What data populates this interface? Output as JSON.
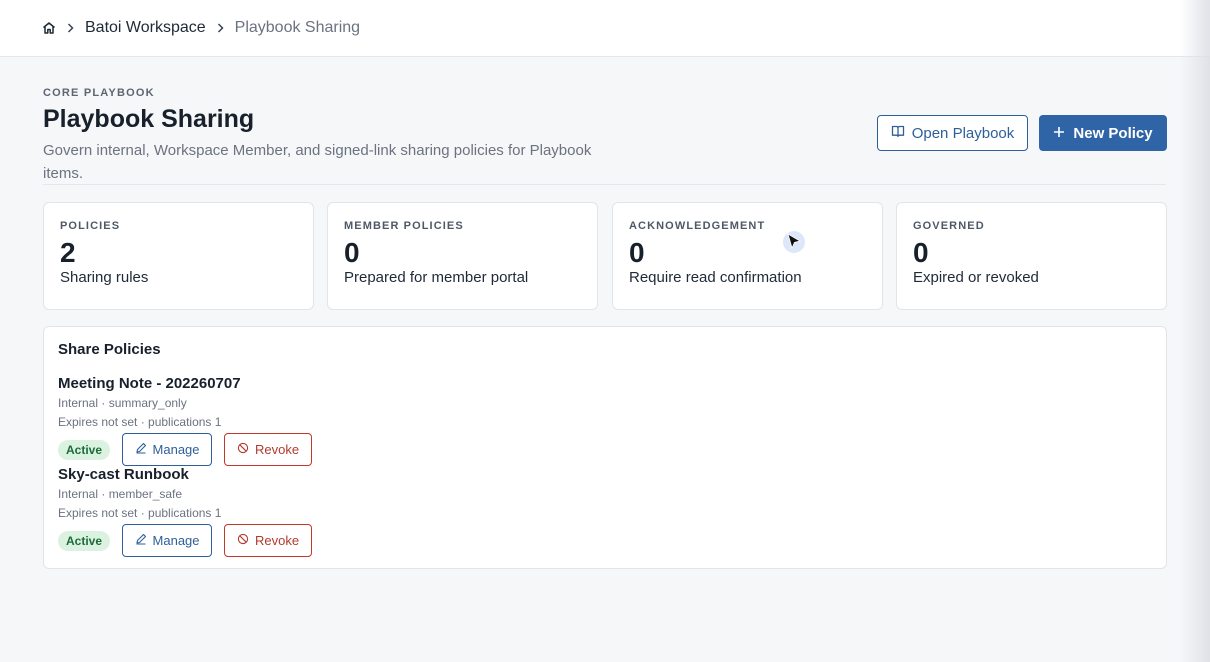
{
  "breadcrumb": {
    "home_icon": "home-icon",
    "items": [
      "Batoi Workspace",
      "Playbook Sharing"
    ]
  },
  "header": {
    "eyebrow": "CORE PLAYBOOK",
    "title": "Playbook Sharing",
    "description": "Govern internal, Workspace Member, and signed-link sharing policies for Playbook items.",
    "open_playbook_label": "Open Playbook",
    "new_policy_label": "New Policy"
  },
  "stats": [
    {
      "label": "POLICIES",
      "value": "2",
      "sub": "Sharing rules"
    },
    {
      "label": "MEMBER POLICIES",
      "value": "0",
      "sub": "Prepared for member portal"
    },
    {
      "label": "ACKNOWLEDGEMENT",
      "value": "0",
      "sub": "Require read confirmation"
    },
    {
      "label": "GOVERNED",
      "value": "0",
      "sub": "Expired or revoked"
    }
  ],
  "policies_panel": {
    "title": "Share Policies",
    "items": [
      {
        "title": "Meeting Note - 202260707",
        "meta": "Internal · summary_only",
        "expires": "Expires not set · publications 1",
        "status": "Active",
        "manage_label": "Manage",
        "revoke_label": "Revoke"
      },
      {
        "title": "Sky-cast Runbook",
        "meta": "Internal · member_safe",
        "expires": "Expires not set · publications 1",
        "status": "Active",
        "manage_label": "Manage",
        "revoke_label": "Revoke"
      }
    ]
  },
  "colors": {
    "primary": "#2f65a6",
    "danger": "#b23a2e",
    "success_bg": "#dcf2e1",
    "success_text": "#1d6b39"
  }
}
